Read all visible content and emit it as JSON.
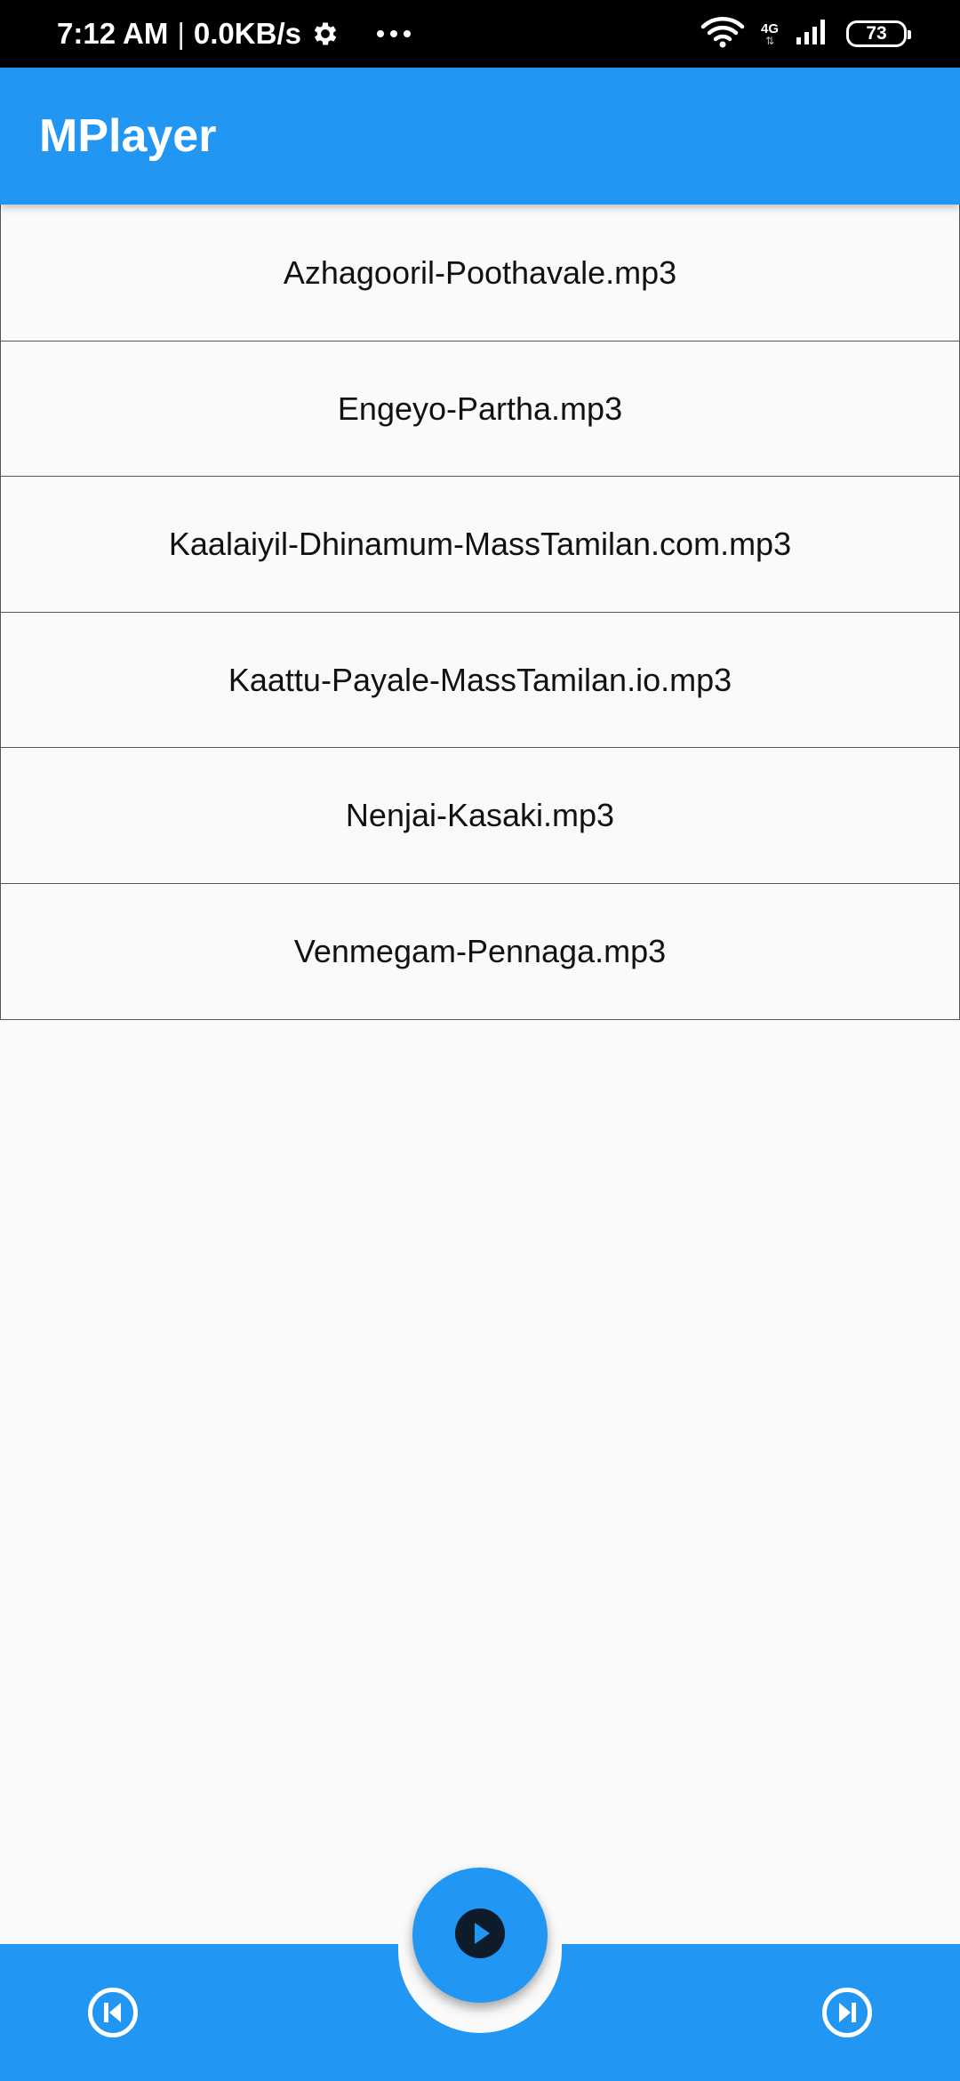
{
  "status_bar": {
    "time": "7:12 AM",
    "separator": "|",
    "net_speed": "0.0KB/s",
    "settings_icon": "gear-icon",
    "more_icon": "ellipsis-icon",
    "wifi_icon": "wifi-icon",
    "network_type": "4G",
    "signal_icon": "cell-signal-icon",
    "battery_level": "73"
  },
  "app_bar": {
    "title": "MPlayer"
  },
  "songs": [
    {
      "title": "Azhagooril-Poothavale.mp3"
    },
    {
      "title": "Engeyo-Partha.mp3"
    },
    {
      "title": "Kaalaiyil-Dhinamum-MassTamilan.com.mp3"
    },
    {
      "title": "Kaattu-Payale-MassTamilan.io.mp3"
    },
    {
      "title": "Nenjai-Kasaki.mp3"
    },
    {
      "title": "Venmegam-Pennaga.mp3"
    }
  ],
  "controls": {
    "previous_icon": "skip-previous-icon",
    "play_icon": "play-icon",
    "next_icon": "skip-next-icon"
  },
  "colors": {
    "primary": "#2196f3",
    "background": "#fafafa",
    "status_bar": "#000000"
  }
}
